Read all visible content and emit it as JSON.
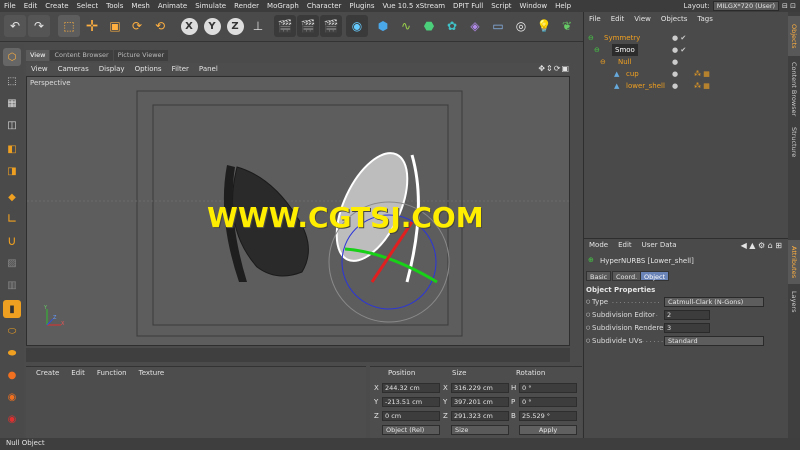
{
  "menubar": {
    "items": [
      "File",
      "Edit",
      "Create",
      "Select",
      "Tools",
      "Mesh",
      "Animate",
      "Simulate",
      "Render",
      "MoGraph",
      "Character",
      "Plugins",
      "Vue 10.5 xStream",
      "DPIT Full",
      "Script",
      "Window",
      "Help"
    ],
    "layout_label": "Layout:",
    "layout_value": "MILGX*720 (User)"
  },
  "toolbar": {
    "icons": [
      "undo-icon",
      "redo-icon",
      "select-icon",
      "move-icon",
      "scale-icon",
      "rotate-icon",
      "recent-icon",
      "x-axis-icon",
      "y-axis-icon",
      "z-axis-icon",
      "coord-system-icon",
      "render-view-icon",
      "render-picture-icon",
      "render-settings-icon",
      "cube-icon",
      "spline-icon",
      "nurbs-icon",
      "array-icon",
      "deformer-icon",
      "floor-icon",
      "camera-icon",
      "light-icon",
      "vue-icon"
    ],
    "axis_labels": [
      "X",
      "Y",
      "Z"
    ]
  },
  "viewport": {
    "tabs": [
      "View",
      "Content Browser",
      "Picture Viewer"
    ],
    "menu": [
      "View",
      "Cameras",
      "Display",
      "Options",
      "Filter",
      "Panel"
    ],
    "label": "Perspective",
    "watermark": "WWW.CGTSJ.COM",
    "axis_labels": {
      "x": "X",
      "y": "Y",
      "z": "Z"
    }
  },
  "materials": {
    "menu": [
      "Create",
      "Edit",
      "Function",
      "Texture"
    ]
  },
  "coordinates": {
    "headers": [
      "Position",
      "Size",
      "Rotation"
    ],
    "rows": [
      {
        "axis": "X",
        "pos": "244.32 cm",
        "size_axis": "X",
        "size": "316.229 cm",
        "rot_axis": "H",
        "rot": "0 °"
      },
      {
        "axis": "Y",
        "pos": "-213.51 cm",
        "size_axis": "Y",
        "size": "397.201 cm",
        "rot_axis": "P",
        "rot": "0 °"
      },
      {
        "axis": "Z",
        "pos": "0 cm",
        "size_axis": "Z",
        "size": "291.323 cm",
        "rot_axis": "B",
        "rot": "25.529 °"
      }
    ],
    "mode_dropdown": "Object (Rel)",
    "size_dropdown": "Size",
    "apply_label": "Apply"
  },
  "objects": {
    "menu": [
      "File",
      "Edit",
      "View",
      "Objects",
      "Tags"
    ],
    "tree": [
      {
        "name": "Symmetry",
        "color": "#f0a020"
      },
      {
        "name": "Smoo",
        "color": "#ffffff"
      },
      {
        "name": "Null",
        "color": "#f0a020"
      },
      {
        "name": "cup",
        "color": "#f0a020"
      },
      {
        "name": "lower_shell",
        "color": "#f0a020"
      }
    ]
  },
  "attributes": {
    "menu": [
      "Mode",
      "Edit",
      "User Data"
    ],
    "object_title": "HyperNURBS [Lower_shell]",
    "tabs": [
      "Basic",
      "Coord.",
      "Object"
    ],
    "active_tab": "Object",
    "section": "Object Properties",
    "props": [
      {
        "label": "Type",
        "dots": ". . . . . . . . . . . . .",
        "value": "Catmull-Clark (N-Gons)",
        "kind": "dropdown"
      },
      {
        "label": "Subdivision Editor",
        "dots": ". .",
        "value": "2",
        "kind": "number"
      },
      {
        "label": "Subdivision Renderer",
        "dots": "",
        "value": "3",
        "kind": "number"
      },
      {
        "label": "Subdivide UVs",
        "dots": ". . . . . .",
        "value": "Standard",
        "kind": "dropdown"
      }
    ]
  },
  "right_tabs": [
    "Objects",
    "Content Browser",
    "Structure",
    "Attributes",
    "Layers"
  ],
  "status": {
    "text": "Null Object"
  },
  "colors": {
    "accent": "#6b84b8",
    "watermark": "#ffee00",
    "object_orange": "#f0a020"
  }
}
